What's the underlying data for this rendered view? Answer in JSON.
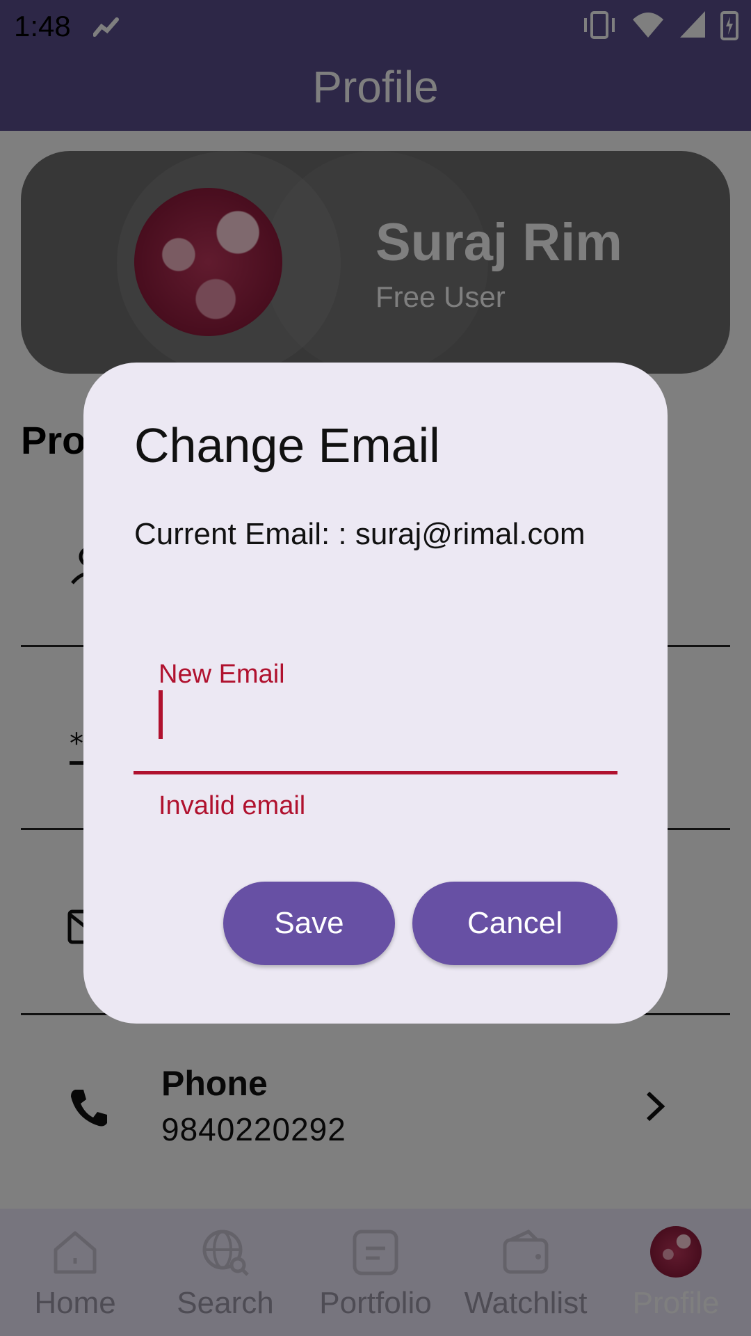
{
  "status_bar": {
    "time": "1:48",
    "icons": [
      "stock-trend-icon",
      "vibrate-icon",
      "wifi-icon",
      "cell-signal-icon",
      "battery-charging-icon"
    ]
  },
  "app_bar": {
    "title": "Profile"
  },
  "profile": {
    "name": "Suraj Rim",
    "subtitle": "Free User"
  },
  "background": {
    "section_title": "Pro",
    "phone": {
      "label": "Phone",
      "value": "9840220292"
    }
  },
  "dialog": {
    "title": "Change Email",
    "current_email_text": "Current Email:  : suraj@rimal.com",
    "input_label": "New Email",
    "input_value": "",
    "error_text": "Invalid email",
    "save_label": "Save",
    "cancel_label": "Cancel"
  },
  "bottom_nav": {
    "items": [
      {
        "label": "Home",
        "icon": "home-icon"
      },
      {
        "label": "Search",
        "icon": "globe-search-icon"
      },
      {
        "label": "Portfolio",
        "icon": "document-icon"
      },
      {
        "label": "Watchlist",
        "icon": "wallet-icon"
      },
      {
        "label": "Profile",
        "icon": "avatar",
        "active": true
      }
    ]
  },
  "colors": {
    "primary": "#6750a4",
    "app_bar": "#5a4f8f",
    "error": "#b0112e",
    "dialog_bg": "#ece8f3"
  }
}
